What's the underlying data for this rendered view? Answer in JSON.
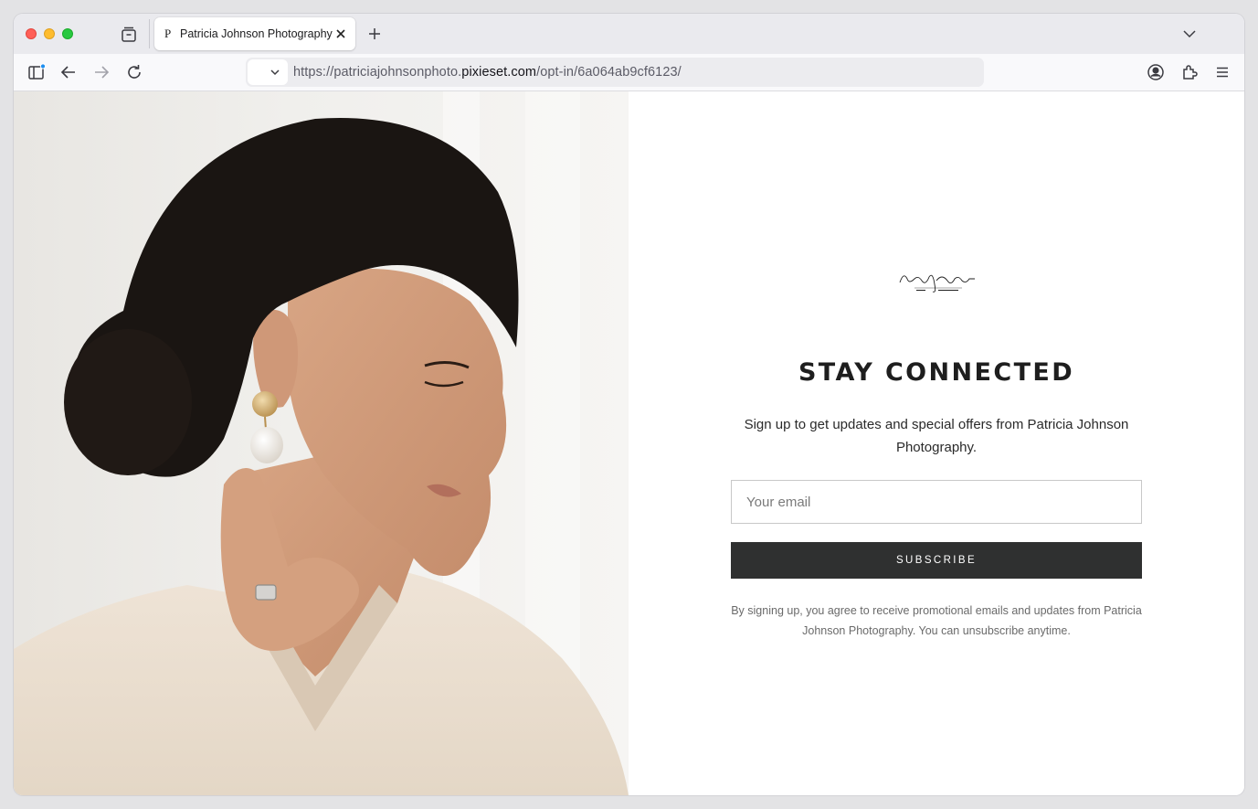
{
  "browser": {
    "tab": {
      "favicon_letter": "P",
      "title": "Patricia Johnson Photography"
    },
    "url": {
      "prefix": "https://patriciajohnsonphoto.",
      "host": "pixieset.com",
      "path": "/opt-in/6a064ab9cf6123/"
    }
  },
  "page": {
    "logo": {
      "script_text": "Patricia Johnson",
      "small_text": "FINE ART · PHOTOGRAPHY"
    },
    "headline": "STAY CONNECTED",
    "subtext": "Sign up to get updates and special offers from Patricia Johnson Photography.",
    "email": {
      "placeholder": "Your email",
      "value": ""
    },
    "subscribe_label": "SUBSCRIBE",
    "disclaimer": "By signing up, you agree to receive promotional emails and updates from Patricia Johnson Photography. You can unsubscribe anytime."
  },
  "colors": {
    "button_bg": "#2f3030",
    "tabstrip_bg": "#eaeaee",
    "toolbar_bg": "#f9f9fb"
  },
  "icons": {
    "toolbar": [
      "sidebar-icon",
      "back-arrow-icon",
      "forward-arrow-icon",
      "reload-icon"
    ],
    "toolbar_right": [
      "account-icon",
      "extensions-icon",
      "menu-icon"
    ]
  }
}
